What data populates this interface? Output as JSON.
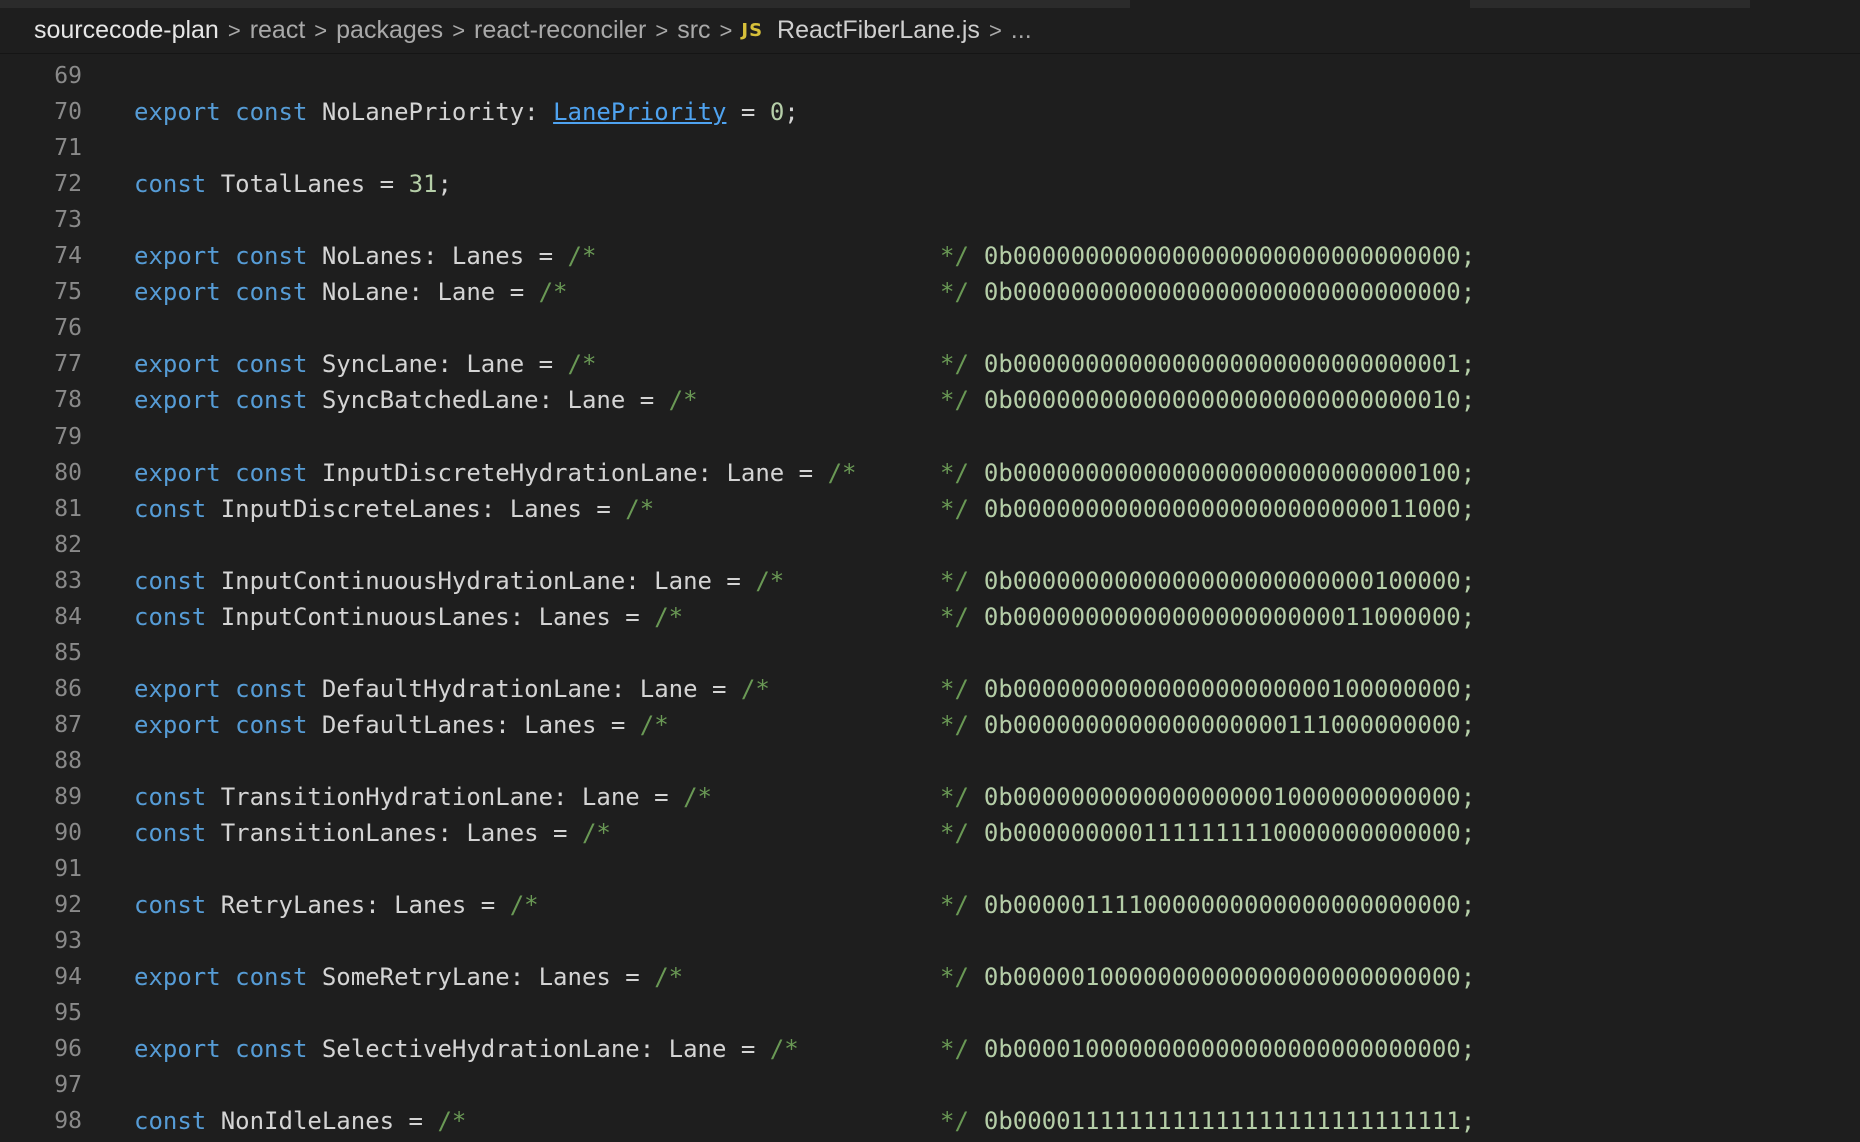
{
  "breadcrumb": {
    "items": [
      "sourcecode-plan",
      "react",
      "packages",
      "react-reconciler",
      "src"
    ],
    "file_badge": "JS",
    "file_name": "ReactFiberLane.js",
    "ellipsis": "...",
    "separator": ">"
  },
  "editor": {
    "comment_open": "/*",
    "comment_close": "*/",
    "lines": [
      {
        "n": "69"
      },
      {
        "n": "70",
        "kind": "priority",
        "export": "export",
        "const": "const",
        "name": "NoLanePriority",
        "colon": ": ",
        "type": "LanePriority",
        "eq": " = ",
        "value": "0",
        "end": ";"
      },
      {
        "n": "71"
      },
      {
        "n": "72",
        "kind": "simple",
        "const": "const",
        "name": "TotalLanes",
        "eq": " = ",
        "value": "31",
        "end": ";"
      },
      {
        "n": "73"
      },
      {
        "n": "74",
        "kind": "lane",
        "export": "export",
        "const": "const",
        "decl": "NoLanes: Lanes = ",
        "bits": "0b0000000000000000000000000000000;"
      },
      {
        "n": "75",
        "kind": "lane",
        "export": "export",
        "const": "const",
        "decl": "NoLane: Lane = ",
        "bits": "0b0000000000000000000000000000000;"
      },
      {
        "n": "76"
      },
      {
        "n": "77",
        "kind": "lane",
        "export": "export",
        "const": "const",
        "decl": "SyncLane: Lane = ",
        "bits": "0b0000000000000000000000000000001;"
      },
      {
        "n": "78",
        "kind": "lane",
        "export": "export",
        "const": "const",
        "decl": "SyncBatchedLane: Lane = ",
        "bits": "0b0000000000000000000000000000010;"
      },
      {
        "n": "79"
      },
      {
        "n": "80",
        "kind": "lane",
        "export": "export",
        "const": "const",
        "decl": "InputDiscreteHydrationLane: Lane = ",
        "bits": "0b0000000000000000000000000000100;"
      },
      {
        "n": "81",
        "kind": "lane",
        "const": "const",
        "decl": "InputDiscreteLanes: Lanes = ",
        "bits": "0b0000000000000000000000000011000;"
      },
      {
        "n": "82"
      },
      {
        "n": "83",
        "kind": "lane",
        "const": "const",
        "decl": "InputContinuousHydrationLane: Lane = ",
        "bits": "0b0000000000000000000000000100000;"
      },
      {
        "n": "84",
        "kind": "lane",
        "const": "const",
        "decl": "InputContinuousLanes: Lanes = ",
        "bits": "0b0000000000000000000000011000000;"
      },
      {
        "n": "85"
      },
      {
        "n": "86",
        "kind": "lane",
        "export": "export",
        "const": "const",
        "decl": "DefaultHydrationLane: Lane = ",
        "bits": "0b0000000000000000000000100000000;"
      },
      {
        "n": "87",
        "kind": "lane",
        "export": "export",
        "const": "const",
        "decl": "DefaultLanes: Lanes = ",
        "bits": "0b0000000000000000000111000000000;"
      },
      {
        "n": "88"
      },
      {
        "n": "89",
        "kind": "lane",
        "const": "const",
        "decl": "TransitionHydrationLane: Lane = ",
        "bits": "0b0000000000000000001000000000000;"
      },
      {
        "n": "90",
        "kind": "lane",
        "const": "const",
        "decl": "TransitionLanes: Lanes = ",
        "bits": "0b0000000001111111110000000000000;"
      },
      {
        "n": "91"
      },
      {
        "n": "92",
        "kind": "lane",
        "const": "const",
        "decl": "RetryLanes: Lanes = ",
        "bits": "0b0000011110000000000000000000000;"
      },
      {
        "n": "93"
      },
      {
        "n": "94",
        "kind": "lane",
        "export": "export",
        "const": "const",
        "decl": "SomeRetryLane: Lanes = ",
        "bits": "0b0000010000000000000000000000000;"
      },
      {
        "n": "95"
      },
      {
        "n": "96",
        "kind": "lane",
        "export": "export",
        "const": "const",
        "decl": "SelectiveHydrationLane: Lane = ",
        "bits": "0b0000100000000000000000000000000;"
      },
      {
        "n": "97"
      },
      {
        "n": "98",
        "kind": "lane",
        "const": "const",
        "decl": "NonIdleLanes = ",
        "bits": "0b0000111111111111111111111111111;"
      }
    ]
  }
}
